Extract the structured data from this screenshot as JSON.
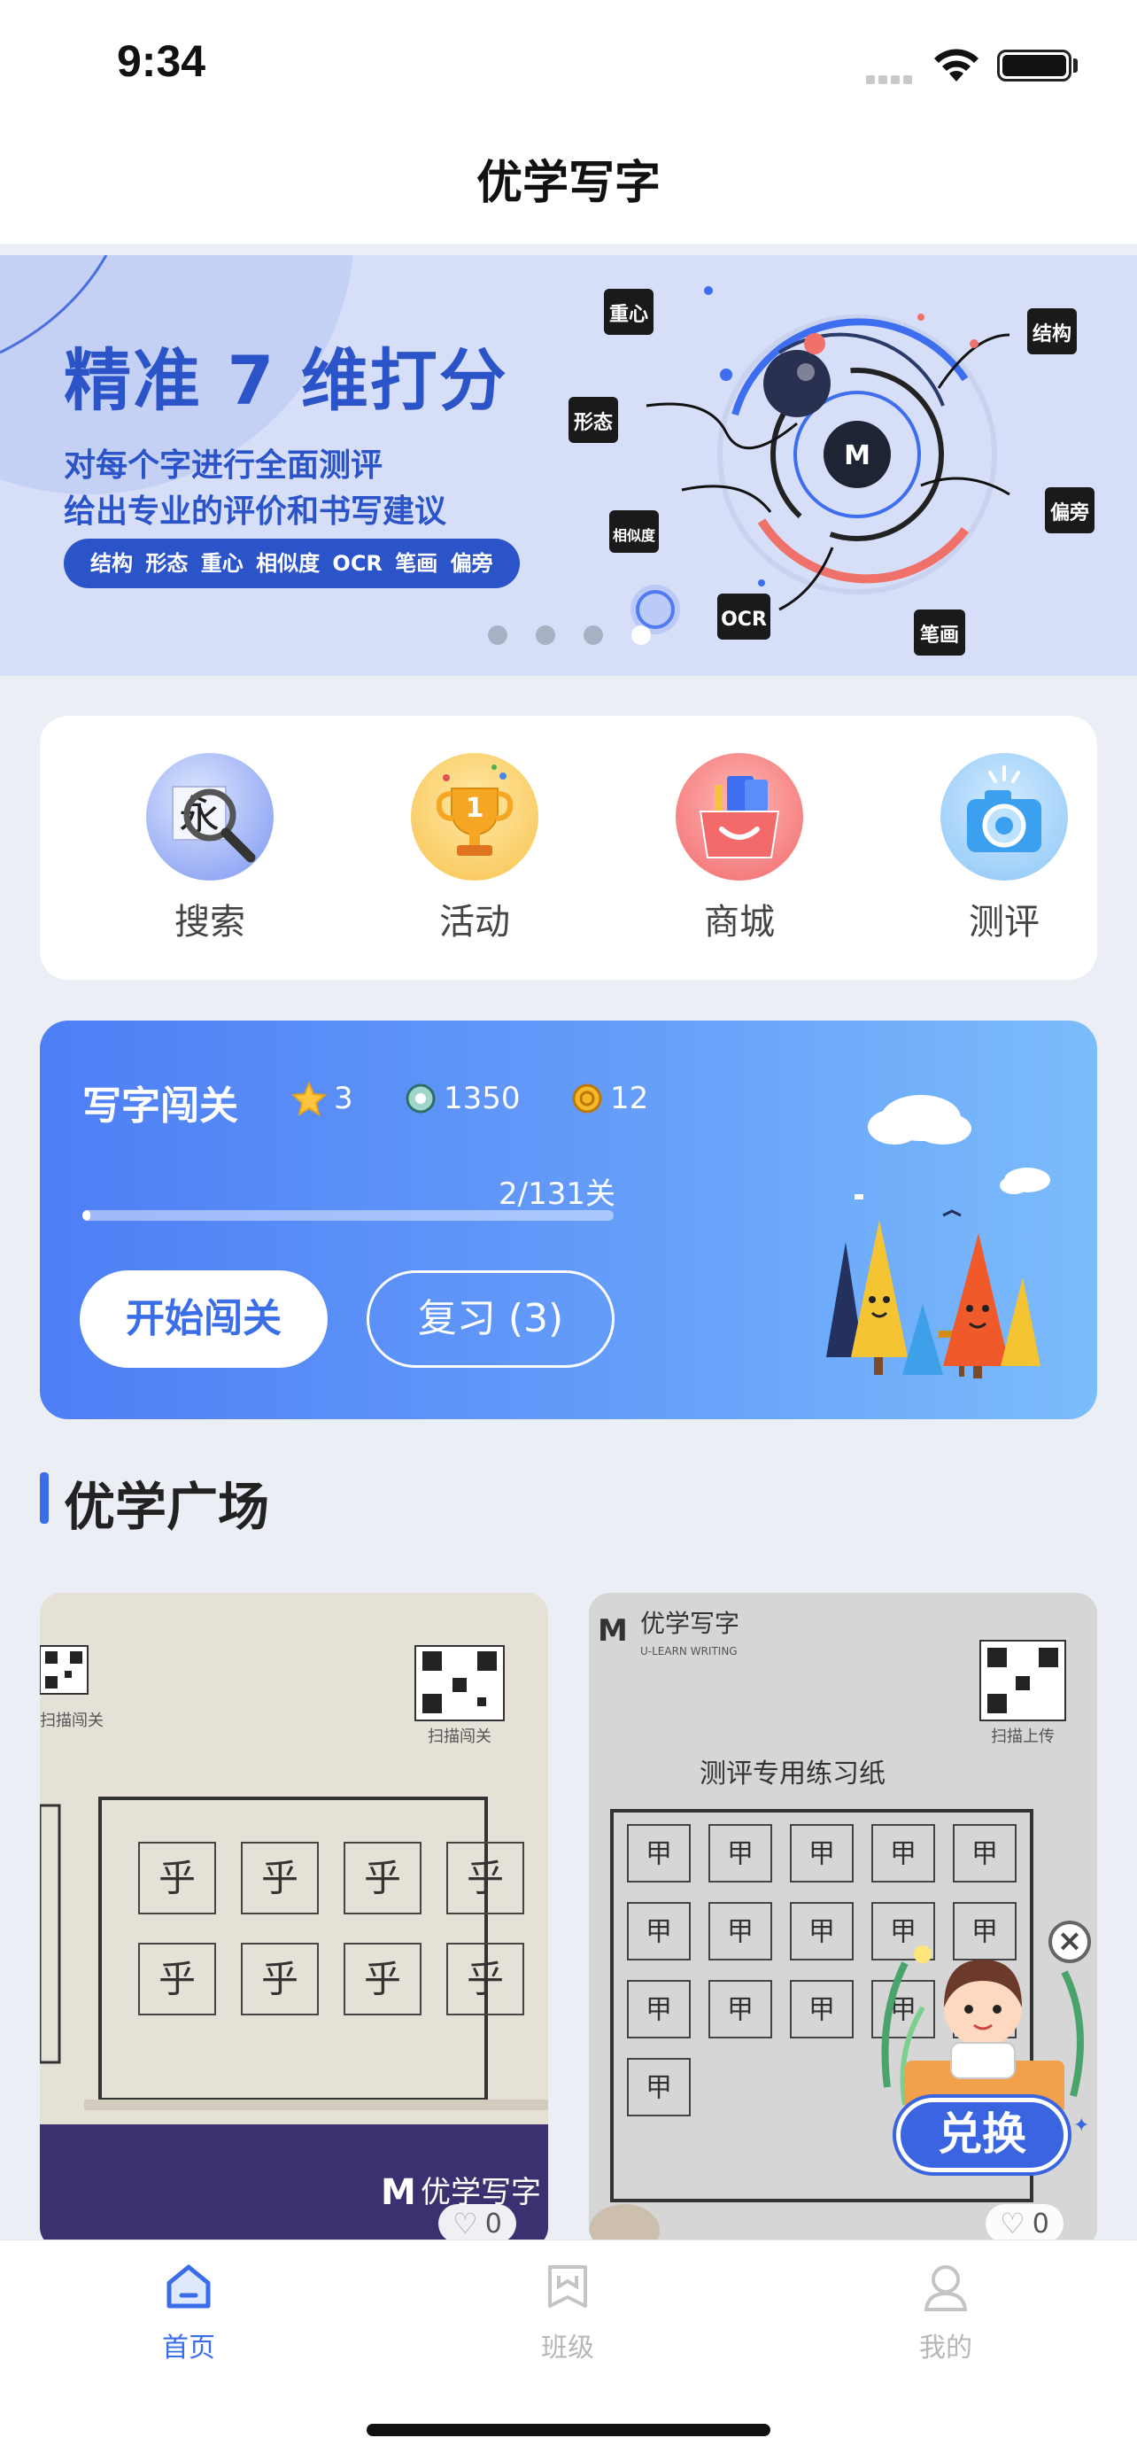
{
  "status_bar": {
    "time": "9:34"
  },
  "header": {
    "title": "优学写字"
  },
  "banner": {
    "title": "精准 7 维打分",
    "subtitle_line1": "对每个字进行全面测评",
    "subtitle_line2": "给出专业的评价和书写建议",
    "pill": "结构 形态 重心 相似度 OCR 笔画 偏旁",
    "tags": [
      "重心",
      "结构",
      "形态",
      "相似度",
      "偏旁",
      "OCR",
      "笔画"
    ],
    "page_count": 4,
    "active_page": 4
  },
  "menu": [
    {
      "label": "搜索",
      "icon": "search-icon"
    },
    {
      "label": "活动",
      "icon": "trophy-icon"
    },
    {
      "label": "商城",
      "icon": "shopping-bag-icon"
    },
    {
      "label": "测评",
      "icon": "camera-icon"
    }
  ],
  "challenge": {
    "title": "写字闯关",
    "stars": "3",
    "points": "1350",
    "coins": "12",
    "progress_label": "2/131关",
    "progress_fraction": 0.015,
    "start_label": "开始闯关",
    "review_label": "复习 (3)"
  },
  "plaza": {
    "title": "优学广场",
    "posts": [
      {
        "likes": "0",
        "qr_caption": "扫描闯关",
        "qr_caption_left": "扫描闯关",
        "characters": [
          "乎",
          "乎",
          "乎",
          "乎",
          "乎",
          "乎",
          "乎",
          "乎"
        ],
        "footer_brand": "优学写字"
      },
      {
        "likes": "0",
        "brand": "优学写字",
        "brand_en": "U-LEARN WRITING",
        "qr_caption": "扫描上传",
        "sheet_title": "测评专用练习纸",
        "characters": [
          "甲",
          "甲",
          "甲",
          "甲",
          "甲",
          "甲",
          "甲",
          "甲",
          "甲",
          "甲",
          "甲",
          "甲",
          "甲",
          "甲",
          "甲",
          "甲"
        ]
      }
    ]
  },
  "float_widget": {
    "label": "兑换",
    "close": "×"
  },
  "tabs": [
    {
      "label": "首页",
      "icon": "home-icon",
      "active": true
    },
    {
      "label": "班级",
      "icon": "class-icon",
      "active": false
    },
    {
      "label": "我的",
      "icon": "profile-icon",
      "active": false
    }
  ],
  "colors": {
    "accent": "#3a6de8",
    "banner_text": "#2c54c9",
    "background": "#eceef6"
  }
}
